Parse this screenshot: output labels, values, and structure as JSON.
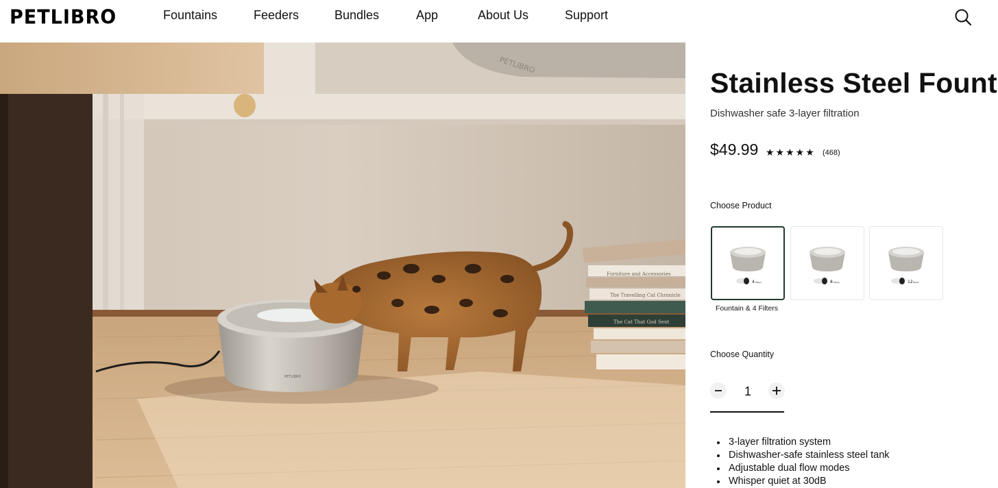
{
  "header": {
    "logo": "PETLIBRO",
    "nav": [
      "Fountains",
      "Feeders",
      "Bundles",
      "App",
      "About Us",
      "Support"
    ],
    "search_icon": "search-icon"
  },
  "hero": {
    "fountain_brand": "PETLIBRO",
    "book_titles": [
      "The Travelling Cat Chr...",
      "Furniture and Accessories",
      "The Travelling Cat Chronicle",
      "The Cat That God Sent"
    ]
  },
  "product": {
    "title": "Stainless Steel Fountain",
    "subtitle": "Dishwasher safe 3-layer filtration",
    "price": "$49.99",
    "rating_stars": "★★★★★",
    "rating": 5,
    "reviews": "(468)",
    "choose_product_label": "Choose Product",
    "options": [
      {
        "filters": "4",
        "unit": "Filters",
        "selected": true
      },
      {
        "filters": "8",
        "unit": "Filters",
        "selected": false
      },
      {
        "filters": "12",
        "unit": "Filters",
        "selected": false
      }
    ],
    "selected_caption": "Fountain & 4 Filters",
    "choose_quantity_label": "Choose Quantity",
    "quantity": "1",
    "minus_icon": "minus-icon",
    "plus_icon": "plus-icon",
    "features": [
      "3-layer filtration system",
      "Dishwasher-safe stainless steel tank",
      "Adjustable dual flow modes",
      "Whisper quiet at 30dB"
    ]
  }
}
